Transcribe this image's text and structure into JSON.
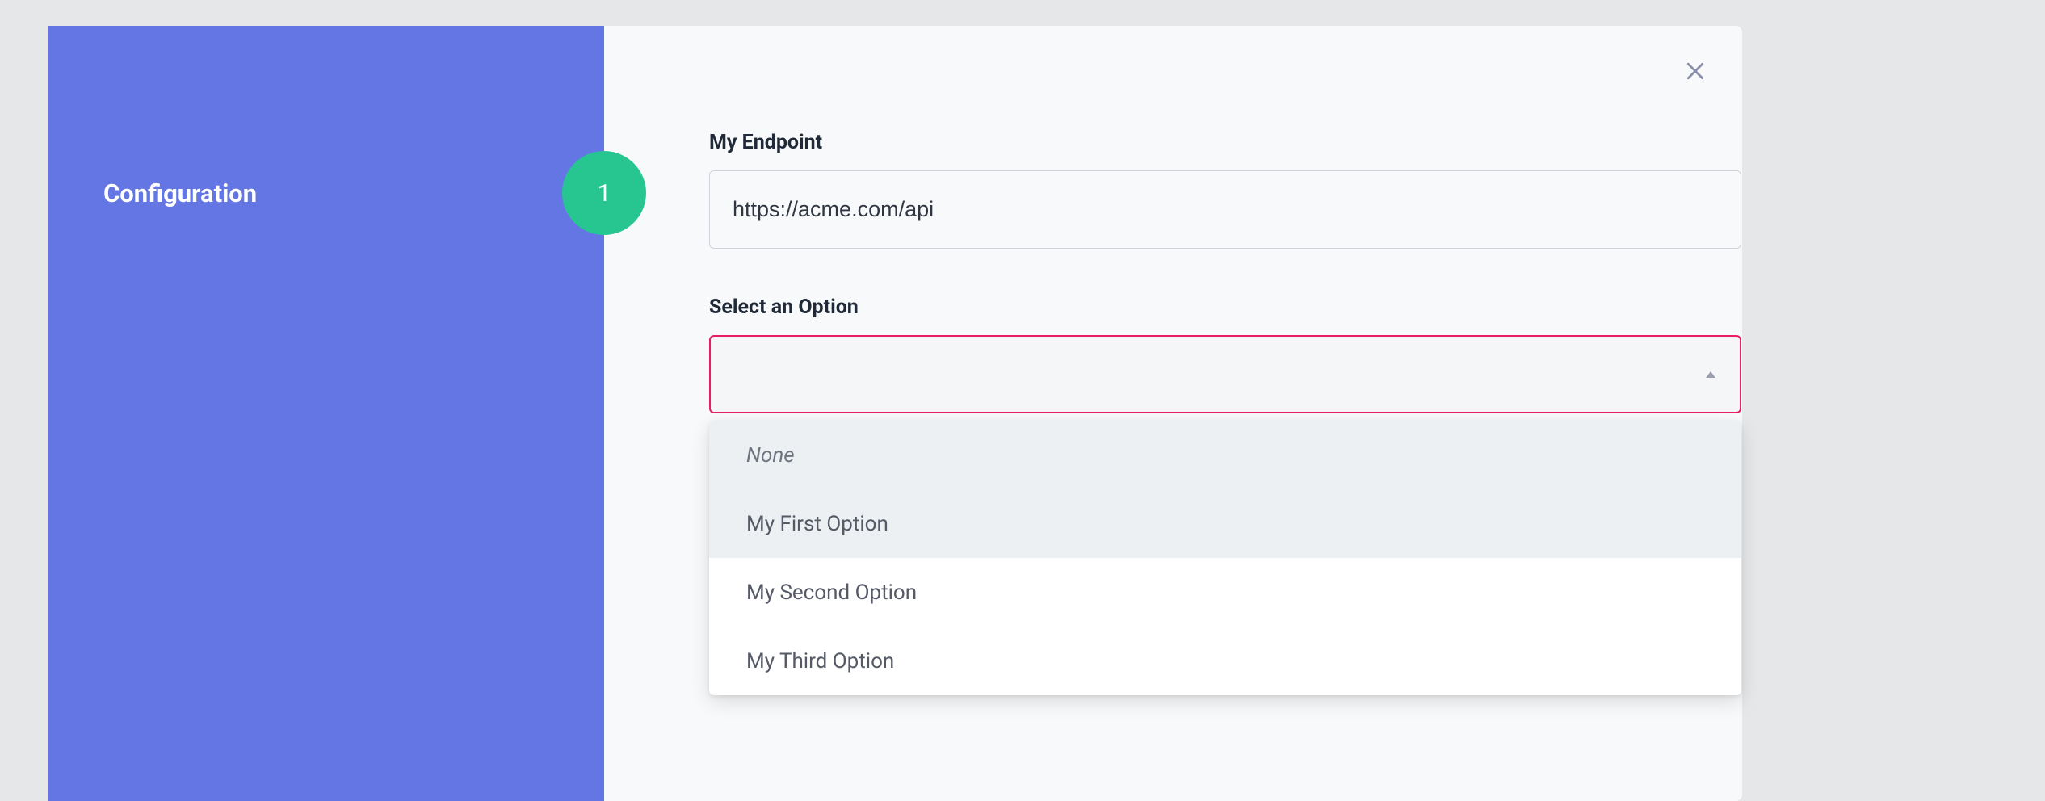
{
  "sidebar": {
    "title": "Configuration",
    "step": "1"
  },
  "form": {
    "endpoint": {
      "label": "My Endpoint",
      "value": "https://acme.com/api"
    },
    "option": {
      "label": "Select an Option",
      "selected": "",
      "options": {
        "none": "None",
        "first": "My First Option",
        "second": "My Second Option",
        "third": "My Third Option"
      }
    }
  }
}
